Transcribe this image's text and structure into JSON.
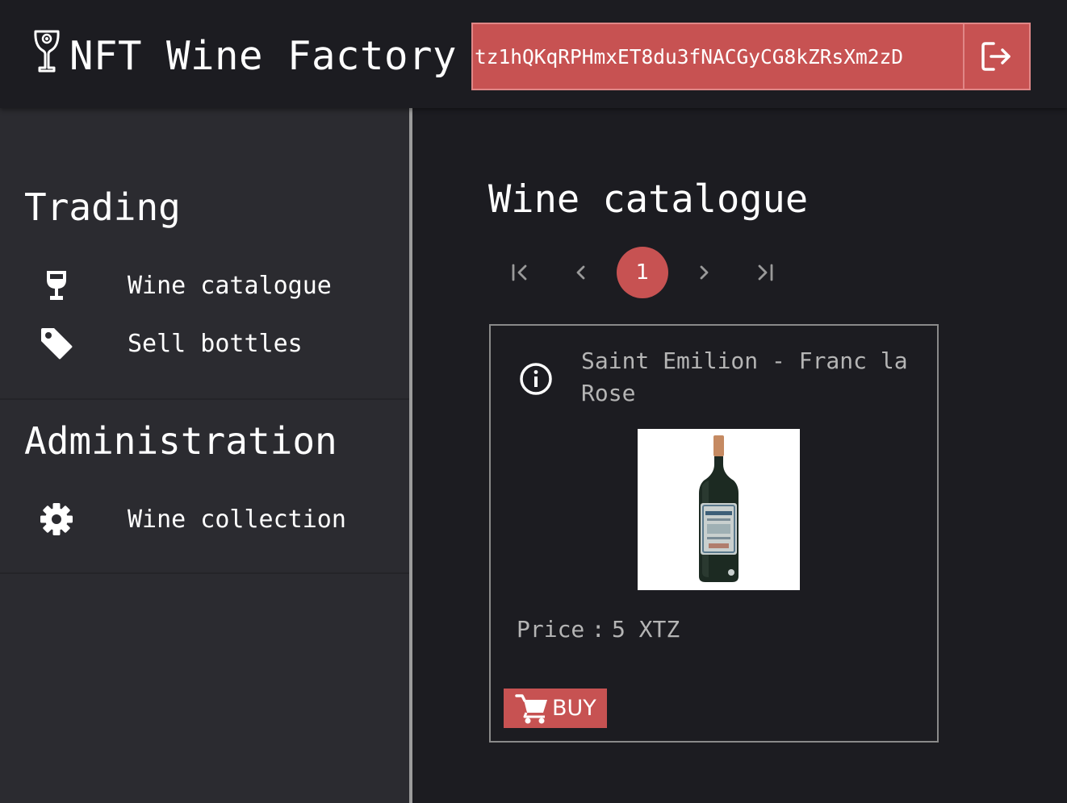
{
  "app": {
    "title": "NFT Wine Factory",
    "logo_icon": "wine-glass-logo-icon"
  },
  "wallet": {
    "address": "tz1hQKqRPHmxET8du3fNACGyCG8kZRsXm2zD",
    "logout_icon": "logout-icon"
  },
  "sidebar": {
    "sections": [
      {
        "title": "Trading",
        "items": [
          {
            "label": "Wine catalogue",
            "icon": "wine-glass-icon"
          },
          {
            "label": "Sell bottles",
            "icon": "tag-icon"
          }
        ]
      },
      {
        "title": "Administration",
        "items": [
          {
            "label": "Wine collection",
            "icon": "gear-icon"
          }
        ]
      }
    ]
  },
  "main": {
    "title": "Wine catalogue",
    "pagination": {
      "current_page": "1",
      "icons": [
        "first-page-icon",
        "prev-page-icon",
        "next-page-icon",
        "last-page-icon"
      ]
    },
    "cards": [
      {
        "name": "Saint Emilion - Franc la Rose",
        "price_label": "Price",
        "price_separator": ":",
        "price_value": "5 XTZ",
        "buy_label": "BUY",
        "info_icon": "info-icon",
        "buy_icon": "cart-icon"
      }
    ]
  },
  "colors": {
    "accent": "#c75252",
    "background": "#1c1c21",
    "sidebar": "#2b2b30",
    "muted_text": "#b5b5b5"
  }
}
